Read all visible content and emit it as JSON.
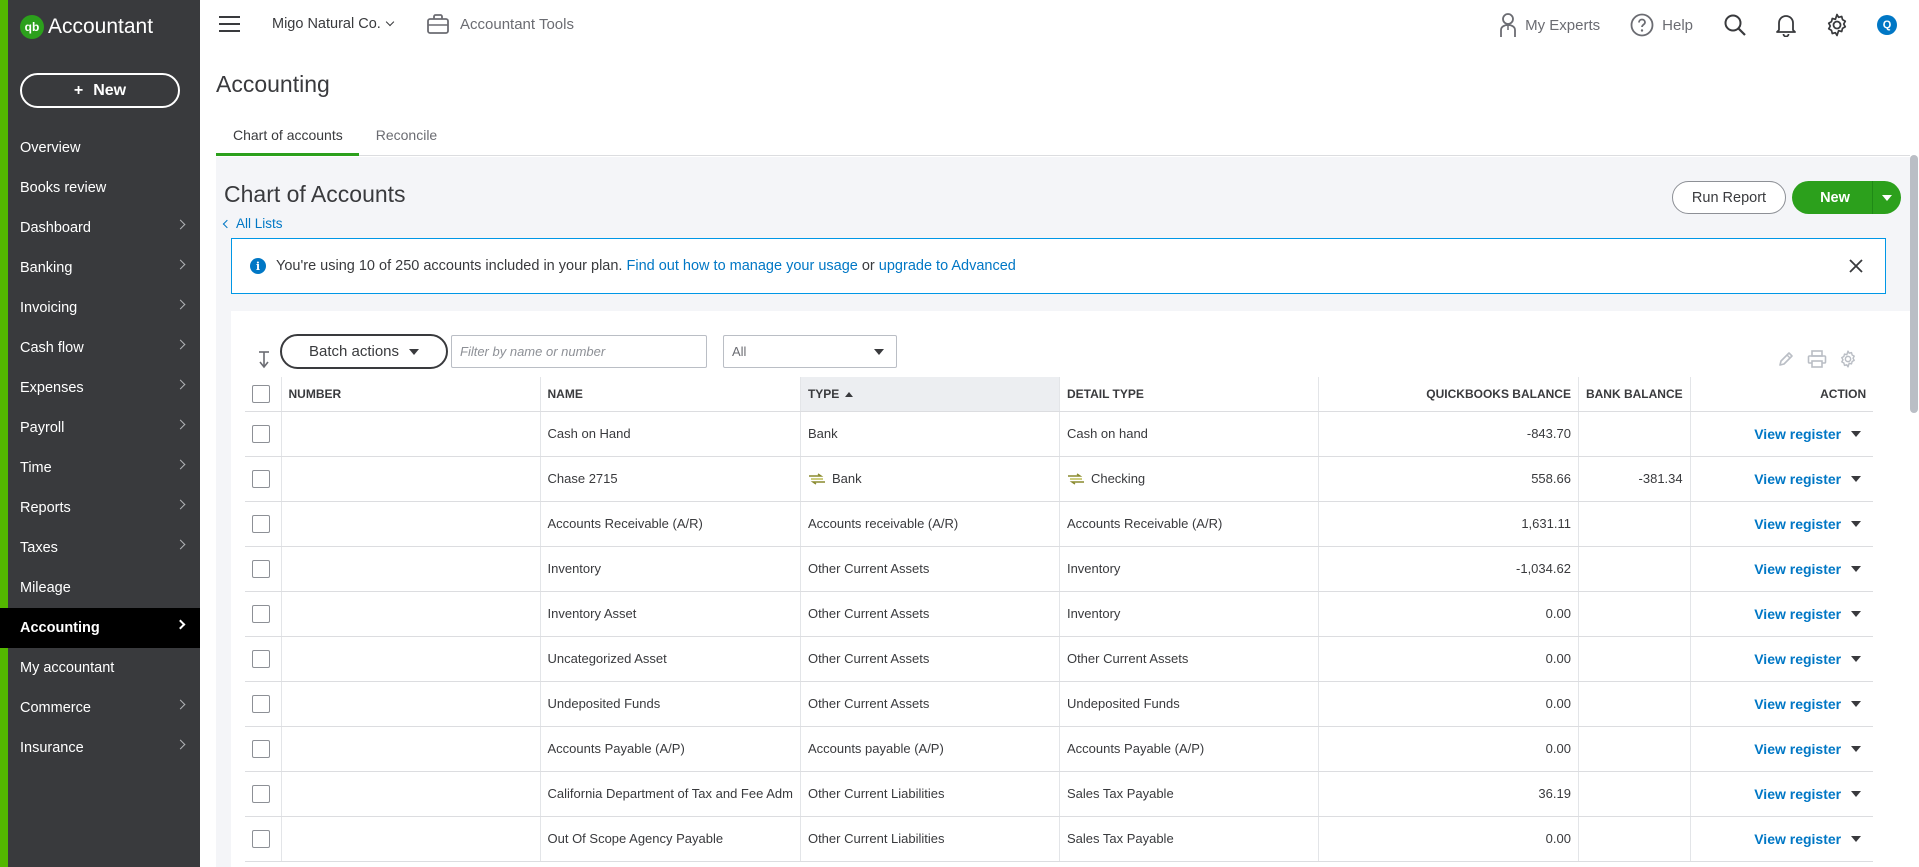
{
  "app": {
    "brand": "Accountant",
    "logo_mark": "qb",
    "new_label": "New",
    "new_plus": "+"
  },
  "sidebar": {
    "items": [
      {
        "label": "Overview",
        "has_chevron": false,
        "active": false
      },
      {
        "label": "Books review",
        "has_chevron": false,
        "active": false
      },
      {
        "label": "Dashboard",
        "has_chevron": true,
        "active": false
      },
      {
        "label": "Banking",
        "has_chevron": true,
        "active": false
      },
      {
        "label": "Invoicing",
        "has_chevron": true,
        "active": false
      },
      {
        "label": "Cash flow",
        "has_chevron": true,
        "active": false
      },
      {
        "label": "Expenses",
        "has_chevron": true,
        "active": false
      },
      {
        "label": "Payroll",
        "has_chevron": true,
        "active": false
      },
      {
        "label": "Time",
        "has_chevron": true,
        "active": false
      },
      {
        "label": "Reports",
        "has_chevron": true,
        "active": false
      },
      {
        "label": "Taxes",
        "has_chevron": true,
        "active": false
      },
      {
        "label": "Mileage",
        "has_chevron": false,
        "active": false
      },
      {
        "label": "Accounting",
        "has_chevron": true,
        "active": true
      },
      {
        "label": "My accountant",
        "has_chevron": false,
        "active": false
      },
      {
        "label": "Commerce",
        "has_chevron": true,
        "active": false
      },
      {
        "label": "Insurance",
        "has_chevron": true,
        "active": false
      }
    ]
  },
  "topbar": {
    "company": "Migo Natural Co.",
    "accountant_tools": "Accountant Tools",
    "my_experts": "My Experts",
    "help": "Help",
    "avatar_initial": "Q"
  },
  "page": {
    "title": "Accounting",
    "tabs": [
      "Chart of accounts",
      "Reconcile"
    ]
  },
  "coa": {
    "title": "Chart of Accounts",
    "all_lists": "All Lists",
    "run_report": "Run Report",
    "new_label": "New"
  },
  "banner": {
    "icon_glyph": "i",
    "text": "You're using 10 of 250 accounts included in your plan.",
    "link1": "Find out how to manage your usage",
    "or": "or",
    "link2": "upgrade to Advanced"
  },
  "toolbar": {
    "batch_actions": "Batch actions",
    "filter_placeholder": "Filter by name or number",
    "type_filter_value": "All"
  },
  "table": {
    "columns": [
      "NUMBER",
      "NAME",
      "TYPE",
      "DETAIL TYPE",
      "QUICKBOOKS BALANCE",
      "BANK BALANCE",
      "ACTION"
    ],
    "action_label": "View register",
    "rows": [
      {
        "number": "",
        "name": "Cash on Hand",
        "type": "Bank",
        "detail": "Cash on hand",
        "qb_balance": "-843.70",
        "bank_balance": "",
        "feed": false
      },
      {
        "number": "",
        "name": "Chase 2715",
        "type": "Bank",
        "detail": "Checking",
        "qb_balance": "558.66",
        "bank_balance": "-381.34",
        "feed": true
      },
      {
        "number": "",
        "name": "Accounts Receivable (A/R)",
        "type": "Accounts receivable (A/R)",
        "detail": "Accounts Receivable (A/R)",
        "qb_balance": "1,631.11",
        "bank_balance": "",
        "feed": false
      },
      {
        "number": "",
        "name": "Inventory",
        "type": "Other Current Assets",
        "detail": "Inventory",
        "qb_balance": "-1,034.62",
        "bank_balance": "",
        "feed": false
      },
      {
        "number": "",
        "name": "Inventory Asset",
        "type": "Other Current Assets",
        "detail": "Inventory",
        "qb_balance": "0.00",
        "bank_balance": "",
        "feed": false
      },
      {
        "number": "",
        "name": "Uncategorized Asset",
        "type": "Other Current Assets",
        "detail": "Other Current Assets",
        "qb_balance": "0.00",
        "bank_balance": "",
        "feed": false
      },
      {
        "number": "",
        "name": "Undeposited Funds",
        "type": "Other Current Assets",
        "detail": "Undeposited Funds",
        "qb_balance": "0.00",
        "bank_balance": "",
        "feed": false
      },
      {
        "number": "",
        "name": "Accounts Payable (A/P)",
        "type": "Accounts payable (A/P)",
        "detail": "Accounts Payable (A/P)",
        "qb_balance": "0.00",
        "bank_balance": "",
        "feed": false
      },
      {
        "number": "",
        "name": "California Department of Tax and Fee Adm",
        "type": "Other Current Liabilities",
        "detail": "Sales Tax Payable",
        "qb_balance": "36.19",
        "bank_balance": "",
        "feed": false
      },
      {
        "number": "",
        "name": "Out Of Scope Agency Payable",
        "type": "Other Current Liabilities",
        "detail": "Sales Tax Payable",
        "qb_balance": "0.00",
        "bank_balance": "",
        "feed": false
      }
    ]
  },
  "colors": {
    "sidebar_bg": "#393a3d",
    "sidebar_accent": "#53b700",
    "primary_green": "#2ca01c",
    "link_blue": "#0077c5",
    "banner_border": "#0097e6"
  },
  "icons": {
    "menu": "hamburger-icon",
    "company_caret": "chevron-down-icon",
    "tools": "briefcase-icon",
    "experts": "person-icon",
    "help": "help-icon",
    "search": "search-icon",
    "notifications": "bell-icon",
    "settings": "gear-icon",
    "info": "info-icon",
    "close": "close-icon",
    "sort": "sort-icon",
    "edit": "pencil-icon",
    "print": "printer-icon",
    "table_settings": "gear-icon",
    "bank_feed": "bank-feed-icon"
  }
}
